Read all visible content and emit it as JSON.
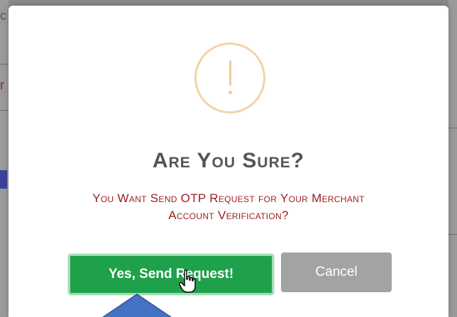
{
  "dialog": {
    "title": "Are You Sure?",
    "message_line1": "You Want Send OTP Request for Your Merchant",
    "message_line2": "Account Verification?",
    "icon": "warning-exclamation-icon",
    "confirm_label": "Yes, Send Request!",
    "cancel_label": "Cancel"
  },
  "colors": {
    "confirm_button": "#1ea14a",
    "cancel_button": "#a3a3a3",
    "message_text": "#9b1c1c",
    "title_text": "#555555",
    "warning_icon": "#f2c799",
    "annotation_arrow": "#4472c4"
  },
  "background": {
    "left_edge_chars": [
      "c",
      "r"
    ]
  }
}
